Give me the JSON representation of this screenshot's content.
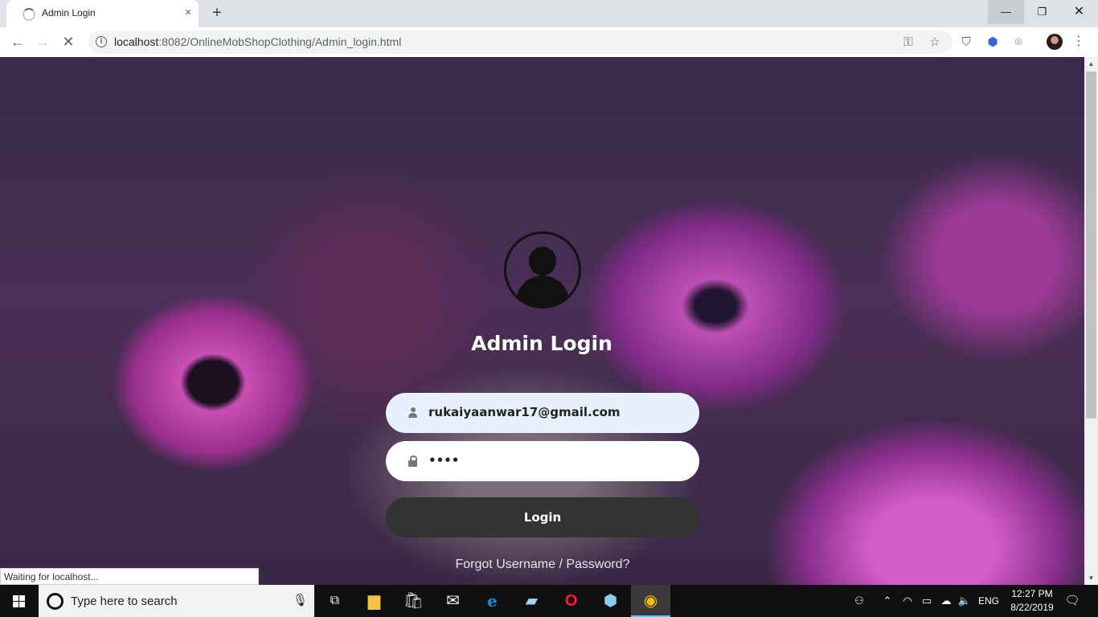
{
  "browser": {
    "tab_title": "Admin Login",
    "tab_close": "×",
    "new_tab": "+",
    "url_host": "localhost",
    "url_rest": ":8082/OnlineMobShopClothing/Admin_login.html",
    "nav": {
      "back": "←",
      "forward": "→",
      "stop": "✕"
    },
    "window": {
      "minimize": "—",
      "maximize": "❐",
      "close": "✕"
    }
  },
  "page": {
    "heading": "Admin Login",
    "email_value": "rukaiyaanwar17@gmail.com",
    "password_value": "••••",
    "login_button": "Login",
    "forgot_link": "Forgot Username / Password?"
  },
  "status_bar": "Waiting for localhost...",
  "taskbar": {
    "search_placeholder": "Type here to search",
    "language": "ENG",
    "time": "12:27 PM",
    "date": "8/22/2019"
  },
  "colors": {
    "login_button_bg": "#333333",
    "email_field_bg": "#e8f0fe",
    "accent_flower": "#c94fb5"
  }
}
